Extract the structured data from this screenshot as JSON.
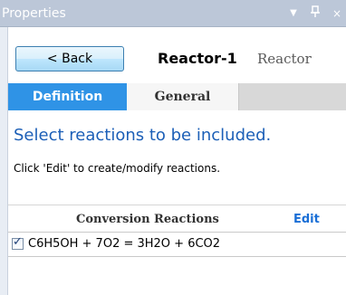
{
  "titlebar": {
    "title": "Properties",
    "dropdown_glyph": "▼",
    "pin_glyph": "ᅟ",
    "close_glyph": "×"
  },
  "header": {
    "back_label": "< Back",
    "object_name": "Reactor-1",
    "object_type": "Reactor"
  },
  "tabs": [
    {
      "label": "Definition",
      "active": true
    },
    {
      "label": "General",
      "active": false
    }
  ],
  "content": {
    "instruction": "Select reactions to be included.",
    "subtext": "Click 'Edit' to create/modify reactions.",
    "section_title": "Conversion Reactions",
    "edit_label": "Edit",
    "reactions": [
      {
        "equation": "C6H5OH + 7O2 = 3H2O + 6CO2",
        "checked": true
      }
    ]
  },
  "colors": {
    "active_tab": "#2f93e6",
    "instruction_text": "#1c5fb7",
    "edit_link": "#1b6fd6",
    "titlebar": "#bcc7d8"
  }
}
